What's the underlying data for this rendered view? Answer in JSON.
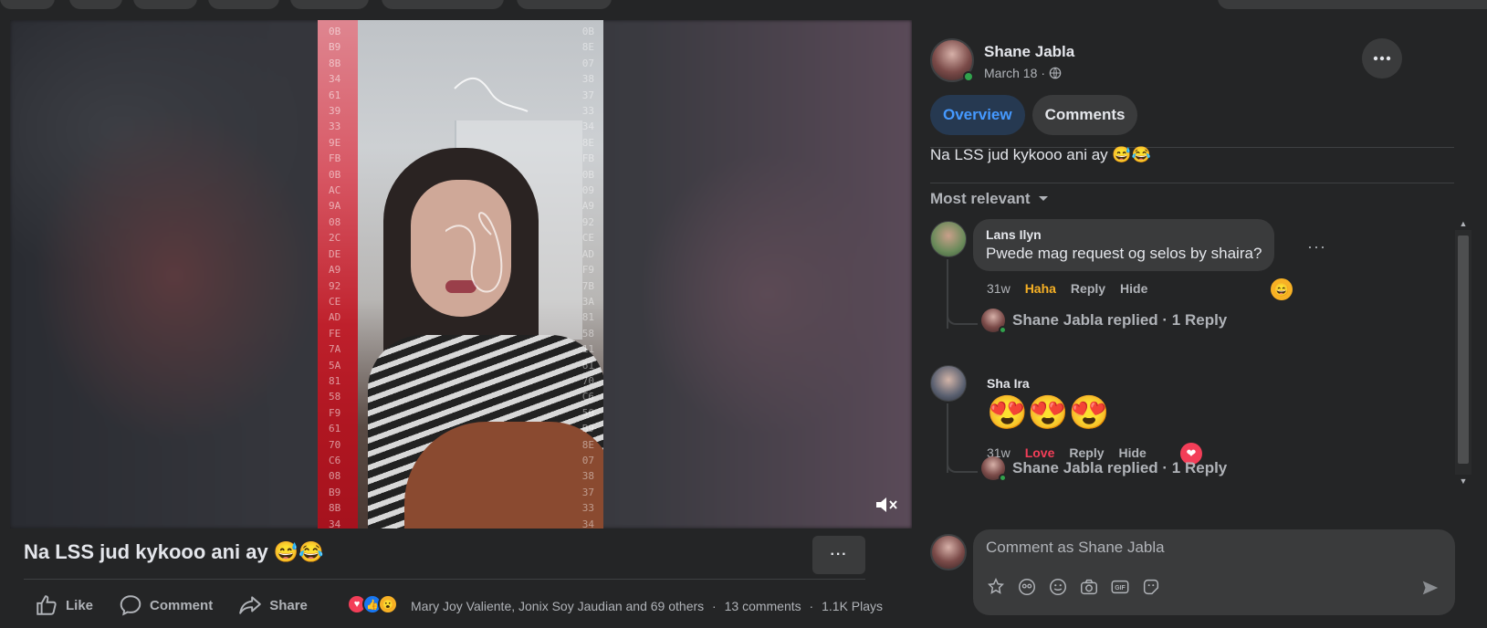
{
  "post": {
    "title": "Na LSS jud kykooo ani ay 😅😂",
    "actions": {
      "like": "Like",
      "comment": "Comment",
      "share": "Share"
    },
    "reactions_text": "Mary Joy Valiente, Jonix Soy Jaudian and 69 others",
    "comments_count": "13 comments",
    "plays": "1.1K Plays",
    "sep": "·",
    "more": "···"
  },
  "author": {
    "name": "Shane Jabla",
    "date": "March 18",
    "sep": "·"
  },
  "tabs": [
    {
      "label": "Overview",
      "active": true
    },
    {
      "label": "Comments",
      "active": false
    }
  ],
  "caption": "Na LSS jud kykooo ani ay 😅😂",
  "sort_label": "Most relevant",
  "comments": [
    {
      "name": "Lans Ilyn",
      "text": "Pwede mag request og selos by shaira?",
      "time": "31w",
      "reaction_label": "Haha",
      "reply": "Reply",
      "hide": "Hide",
      "badge": "😄",
      "replied": "Shane Jabla replied · 1 Reply"
    },
    {
      "name": "Sha Ira",
      "text": "😍😍😍",
      "time": "31w",
      "reaction_label": "Love",
      "reply": "Reply",
      "hide": "Hide",
      "badge": "❤",
      "replied": "Shane Jabla replied · 1 Reply"
    }
  ],
  "composer": {
    "placeholder": "Comment as Shane Jabla"
  },
  "colors": {
    "background": "#242526",
    "accent": "#4599ff",
    "haha": "#f7b125",
    "love": "#f33e58",
    "online": "#31a24c"
  },
  "icons": [
    "like-icon",
    "comment-icon",
    "share-icon",
    "mute-icon",
    "globe-icon",
    "chevron-down-icon",
    "send-icon"
  ]
}
